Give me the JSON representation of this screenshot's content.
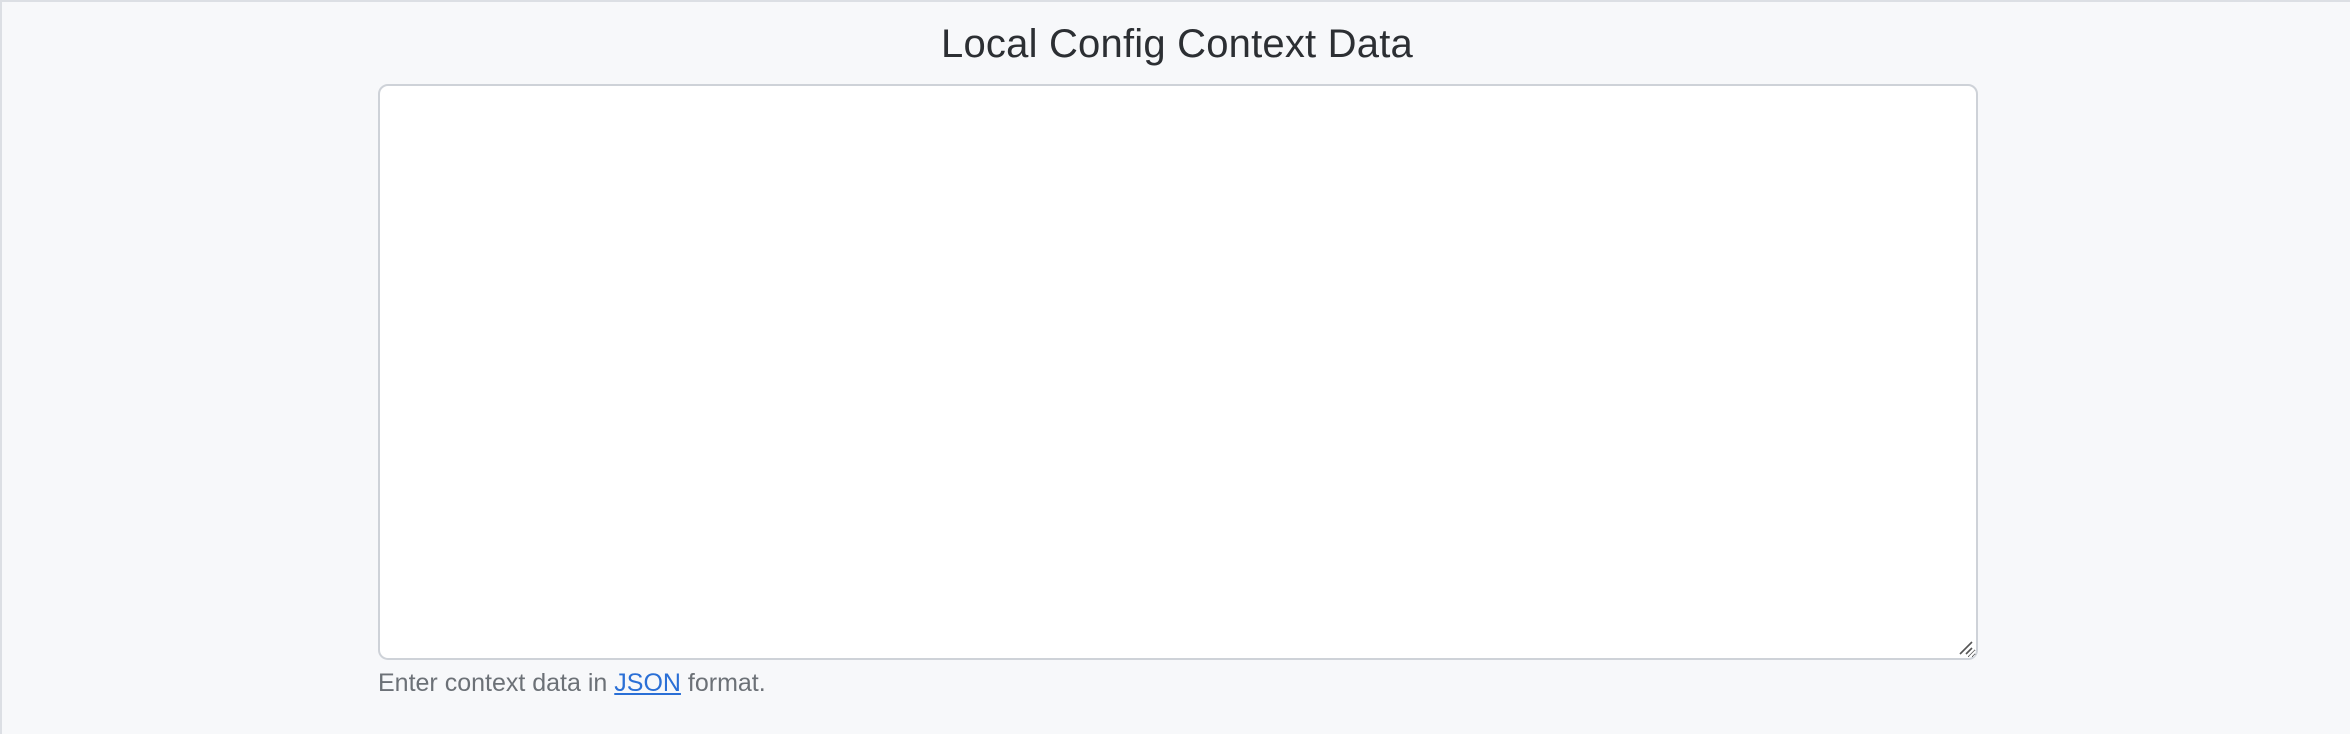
{
  "section": {
    "title": "Local Config Context Data"
  },
  "field": {
    "value": "",
    "placeholder": ""
  },
  "help": {
    "prefix": "Enter context data in ",
    "link_text": "JSON",
    "suffix": " format."
  },
  "icons": {
    "resize": "resize-handle-icon"
  },
  "colors": {
    "background": "#f7f8fa",
    "link": "#2a6fd6",
    "help_text": "#6c7177",
    "title_text": "#2c2f33"
  }
}
